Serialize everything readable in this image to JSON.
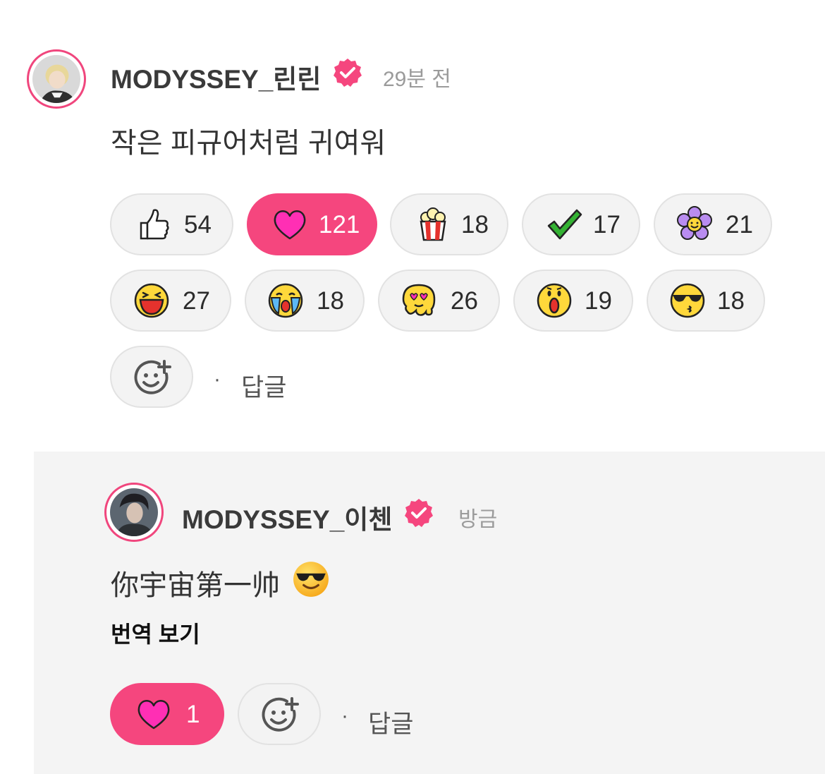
{
  "comment": {
    "username": "MODYSSEY_린린",
    "time": "29분 전",
    "text": "작은 피규어처럼 귀여워",
    "reactions": [
      {
        "icon": "thumbs-up-icon",
        "count": "54",
        "active": false
      },
      {
        "icon": "heart-icon",
        "count": "121",
        "active": true
      },
      {
        "icon": "popcorn-icon",
        "count": "18",
        "active": false
      },
      {
        "icon": "checkmark-icon",
        "count": "17",
        "active": false
      },
      {
        "icon": "flower-icon",
        "count": "21",
        "active": false
      },
      {
        "icon": "laughing-face-icon",
        "count": "27",
        "active": false
      },
      {
        "icon": "crying-face-icon",
        "count": "18",
        "active": false
      },
      {
        "icon": "melting-love-face-icon",
        "count": "26",
        "active": false
      },
      {
        "icon": "surprised-face-icon",
        "count": "19",
        "active": false
      },
      {
        "icon": "sunglasses-face-icon",
        "count": "18",
        "active": false
      }
    ],
    "reply_label": "답글",
    "separator": "·"
  },
  "reply": {
    "username": "MODYSSEY_이첸",
    "time": "방금",
    "text": "你宇宙第一帅",
    "translate_label": "번역 보기",
    "reactions": [
      {
        "icon": "heart-icon",
        "count": "1",
        "active": true
      }
    ],
    "reply_label": "답글",
    "separator": "·"
  },
  "colors": {
    "accent": "#f5467e",
    "pill_bg": "#f3f3f3",
    "reply_bg": "#f4f4f4"
  }
}
